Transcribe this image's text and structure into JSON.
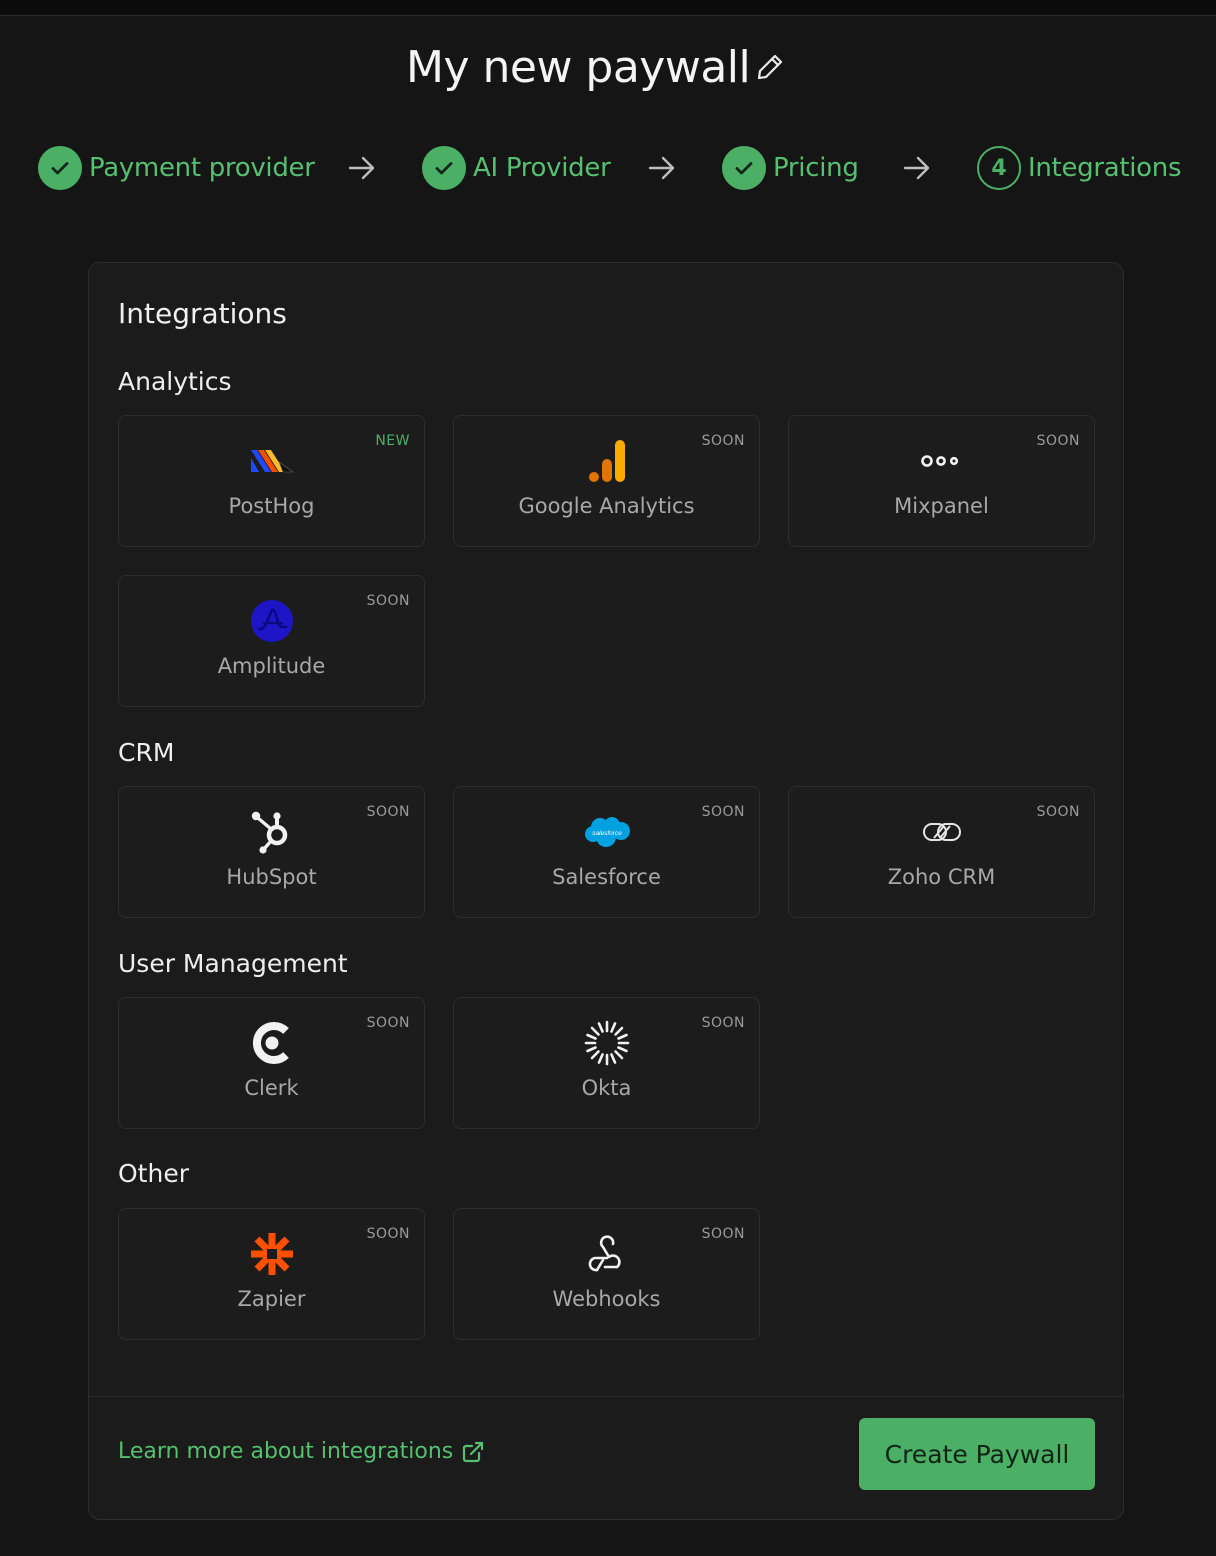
{
  "page": {
    "title": "My new paywall"
  },
  "stepper": {
    "steps": [
      {
        "label": "Payment provider",
        "status": "complete"
      },
      {
        "label": "AI Provider",
        "status": "complete"
      },
      {
        "label": "Pricing",
        "status": "complete"
      },
      {
        "label": "Integrations",
        "status": "current",
        "number": "4"
      }
    ]
  },
  "card": {
    "title": "Integrations",
    "sections": [
      {
        "title": "Analytics",
        "items": [
          {
            "name": "PostHog",
            "badge": "NEW",
            "icon": "posthog-logo"
          },
          {
            "name": "Google Analytics",
            "badge": "SOON",
            "icon": "google-analytics-logo"
          },
          {
            "name": "Mixpanel",
            "badge": "SOON",
            "icon": "mixpanel-logo"
          },
          {
            "name": "Amplitude",
            "badge": "SOON",
            "icon": "amplitude-logo"
          }
        ]
      },
      {
        "title": "CRM",
        "items": [
          {
            "name": "HubSpot",
            "badge": "SOON",
            "icon": "hubspot-logo"
          },
          {
            "name": "Salesforce",
            "badge": "SOON",
            "icon": "salesforce-logo",
            "logo_text": "salesforce"
          },
          {
            "name": "Zoho CRM",
            "badge": "SOON",
            "icon": "zoho-logo"
          }
        ]
      },
      {
        "title": "User Management",
        "items": [
          {
            "name": "Clerk",
            "badge": "SOON",
            "icon": "clerk-logo"
          },
          {
            "name": "Okta",
            "badge": "SOON",
            "icon": "okta-logo"
          }
        ]
      },
      {
        "title": "Other",
        "items": [
          {
            "name": "Zapier",
            "badge": "SOON",
            "icon": "zapier-logo"
          },
          {
            "name": "Webhooks",
            "badge": "SOON",
            "icon": "webhook-icon"
          }
        ]
      }
    ]
  },
  "footer": {
    "learn_more": "Learn more about integrations",
    "create_button": "Create Paywall"
  },
  "colors": {
    "accent": "#4caf66",
    "background": "#151515",
    "card": "#1b1b1b"
  }
}
